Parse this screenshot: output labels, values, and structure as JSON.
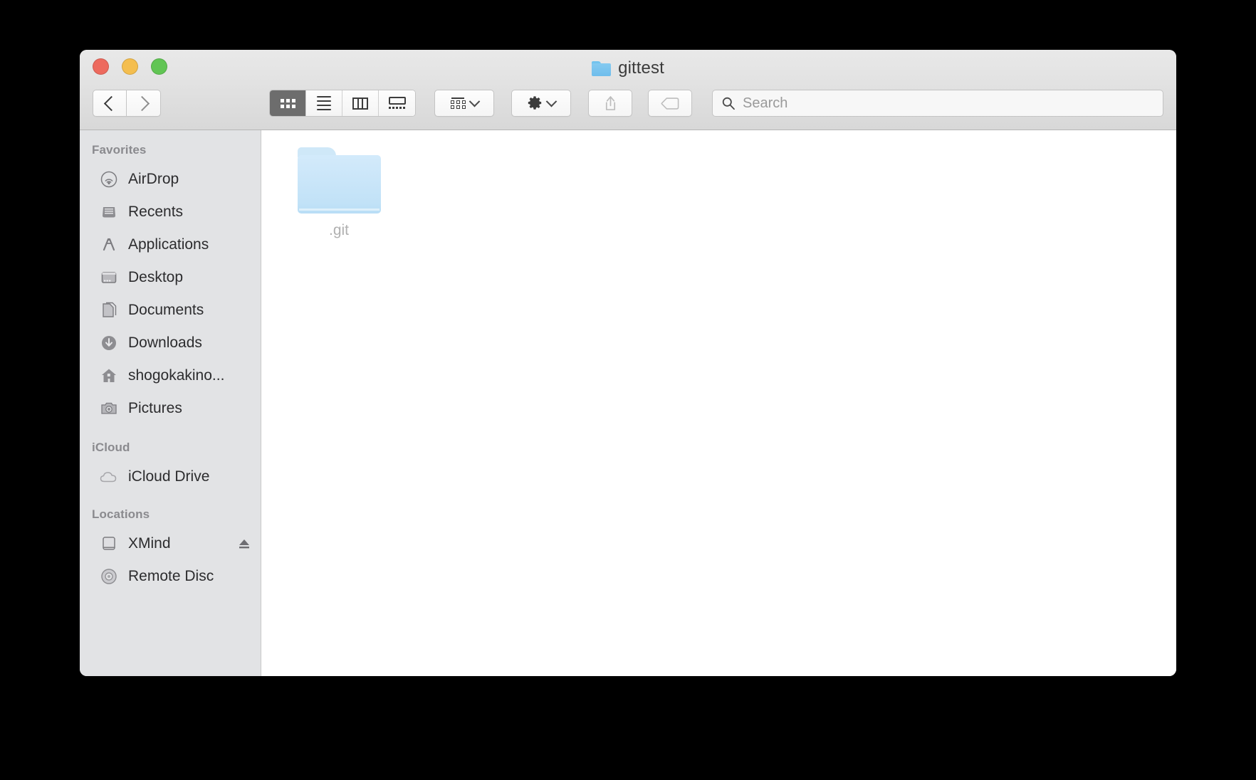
{
  "window": {
    "title": "gittest",
    "title_icon": "folder-icon",
    "traffic_lights": [
      {
        "name": "close-button",
        "color": "#ED6A5E"
      },
      {
        "name": "minimize-button",
        "color": "#F4BE4F"
      },
      {
        "name": "maximize-button",
        "color": "#61C554"
      }
    ]
  },
  "toolbar": {
    "back_label": "back-chevron-icon",
    "forward_label": "forward-chevron-icon",
    "view_modes": [
      {
        "name": "icon-view",
        "icon": "grid-icon",
        "active": true
      },
      {
        "name": "list-view",
        "icon": "list-icon",
        "active": false
      },
      {
        "name": "column-view",
        "icon": "columns-icon",
        "active": false
      },
      {
        "name": "gallery-view",
        "icon": "gallery-icon",
        "active": false
      }
    ],
    "arrange": {
      "name": "arrange-button",
      "icon": "arrange-icon"
    },
    "action": {
      "name": "action-button",
      "icon": "gear-icon"
    },
    "share": {
      "name": "share-button",
      "icon": "share-icon"
    },
    "tags": {
      "name": "tags-button",
      "icon": "tag-icon"
    }
  },
  "search": {
    "placeholder": "Search",
    "value": "",
    "icon": "search-icon"
  },
  "sidebar": {
    "sections": [
      {
        "header": "Favorites",
        "items": [
          {
            "label": "AirDrop",
            "icon": "airdrop-icon",
            "eject": false
          },
          {
            "label": "Recents",
            "icon": "recents-icon",
            "eject": false
          },
          {
            "label": "Applications",
            "icon": "applications-icon",
            "eject": false
          },
          {
            "label": "Desktop",
            "icon": "desktop-icon",
            "eject": false
          },
          {
            "label": "Documents",
            "icon": "documents-icon",
            "eject": false
          },
          {
            "label": "Downloads",
            "icon": "downloads-icon",
            "eject": false
          },
          {
            "label": "shogokakino...",
            "icon": "home-icon",
            "eject": false
          },
          {
            "label": "Pictures",
            "icon": "pictures-icon",
            "eject": false
          }
        ]
      },
      {
        "header": "iCloud",
        "items": [
          {
            "label": "iCloud Drive",
            "icon": "cloud-icon",
            "eject": false
          }
        ]
      },
      {
        "header": "Locations",
        "items": [
          {
            "label": "XMind",
            "icon": "external-drive-icon",
            "eject": true
          },
          {
            "label": "Remote Disc",
            "icon": "optical-disc-icon",
            "eject": false
          }
        ]
      }
    ]
  },
  "content": {
    "files": [
      {
        "name": ".git",
        "icon": "folder-icon",
        "dimmed": true
      }
    ]
  }
}
